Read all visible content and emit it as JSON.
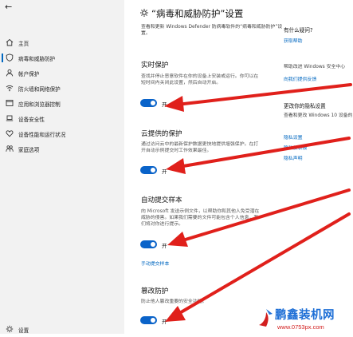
{
  "window": {
    "back_glyph": "←"
  },
  "sidebar": {
    "items": [
      {
        "label": "主页",
        "icon": "home-icon"
      },
      {
        "label": "病毒和威胁防护",
        "icon": "shield-icon",
        "selected": true
      },
      {
        "label": "帐户保护",
        "icon": "person-icon"
      },
      {
        "label": "防火墙和网络保护",
        "icon": "wifi-icon"
      },
      {
        "label": "应用和浏览器控制",
        "icon": "app-window-icon"
      },
      {
        "label": "设备安全性",
        "icon": "laptop-icon"
      },
      {
        "label": "设备性能和运行状况",
        "icon": "heart-icon"
      },
      {
        "label": "家庭选项",
        "icon": "family-icon"
      }
    ],
    "settings_label": "设置"
  },
  "main": {
    "title": "“病毒和威胁防护”设置",
    "intro": "查看和更新 Windows Defender 防病毒软件的“病毒和威胁防护”设置。",
    "sections": [
      {
        "title": "实时保护",
        "desc": "查找并停止恶意软件在你的设备上安装或运行。你可以在短时间内关闭此设置，然后自动开启。",
        "toggle_label": "开"
      },
      {
        "title": "云提供的保护",
        "desc": "通过访问云中的最新保护数据更快地提供增强保护。在打开自动示例提交时工作效果最佳。",
        "toggle_label": "开"
      },
      {
        "title": "自动提交样本",
        "desc": "向 Microsoft 发送示例文件，以帮助你和其他人免受潜在威胁的侵害。如果我们需要的文件可能包含个人信息，我们将对你进行提示。",
        "toggle_label": "开",
        "link": "手动提交样本"
      },
      {
        "title": "篡改防护",
        "desc": "防止他人篡改重要的安全功能。",
        "toggle_label": "开"
      }
    ]
  },
  "right_column": {
    "question_title": "有什么疑问?",
    "get_help": "获取帮助",
    "improve_title": "帮助改进 Windows 安全中心",
    "feedback": "向我们提供反馈",
    "privacy_title": "更改你的隐私设置",
    "privacy_text": "查看和更改 Windows 10 设备的隐私设置。",
    "privacy_settings": "隐私设置",
    "privacy_dashboard": "隐私仪表板",
    "privacy_statement": "隐私声明"
  },
  "watermark": {
    "name": "鹏鑫装机网",
    "url": "www.0753px.com"
  },
  "colors": {
    "accent": "#0067c0",
    "toggle_on": "#0a63c9",
    "annotation_arrow": "#e0201b",
    "sidebar_bg": "#f2f2f2"
  }
}
